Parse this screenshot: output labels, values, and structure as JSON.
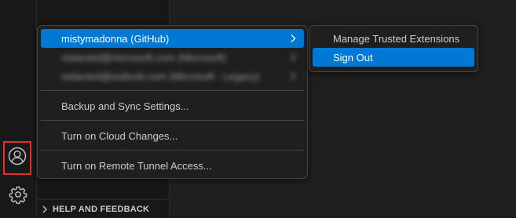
{
  "sidebar": {
    "help_section_label": "HELP AND FEEDBACK"
  },
  "activity_bar": {
    "account_icon": "account-icon",
    "gear_icon": "gear-icon"
  },
  "accounts_menu": {
    "items": [
      {
        "label": "mistymadonna (GitHub)",
        "has_submenu": true,
        "active": true
      },
      {
        "label": "redacted@microsoft.com (Microsoft)",
        "has_submenu": true,
        "active": false,
        "redacted": true
      },
      {
        "label": "redacted@outlook.com (Microsoft - Legacy)",
        "has_submenu": true,
        "active": false,
        "redacted": true
      }
    ],
    "actions": [
      {
        "label": "Backup and Sync Settings..."
      },
      {
        "label": "Turn on Cloud Changes..."
      },
      {
        "label": "Turn on Remote Tunnel Access..."
      }
    ]
  },
  "account_submenu": {
    "items": [
      {
        "label": "Manage Trusted Extensions",
        "active": false
      },
      {
        "label": "Sign Out",
        "active": true
      }
    ]
  },
  "colors": {
    "accent": "#0078d4",
    "highlight_border": "#e03131",
    "menu_bg": "#1f1f1f",
    "text": "#cccccc"
  }
}
